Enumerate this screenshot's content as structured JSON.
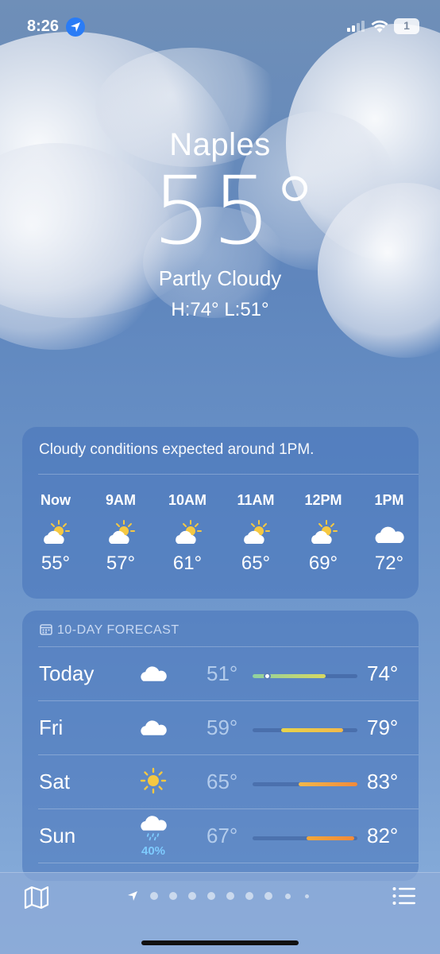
{
  "status_bar": {
    "time": "8:26",
    "battery": "1"
  },
  "location": {
    "city": "Naples",
    "temperature": "55°",
    "condition": "Partly Cloudy",
    "high_low": "H:74°  L:51°"
  },
  "hourly": {
    "summary": "Cloudy conditions expected around 1PM.",
    "hours": [
      {
        "label": "Now",
        "icon": "partly-cloudy-icon",
        "temp": "55°"
      },
      {
        "label": "9AM",
        "icon": "partly-cloudy-icon",
        "temp": "57°"
      },
      {
        "label": "10AM",
        "icon": "partly-cloudy-icon",
        "temp": "61°"
      },
      {
        "label": "11AM",
        "icon": "partly-cloudy-icon",
        "temp": "65°"
      },
      {
        "label": "12PM",
        "icon": "partly-cloudy-icon",
        "temp": "69°"
      },
      {
        "label": "1PM",
        "icon": "cloud-icon",
        "temp": "72°"
      }
    ]
  },
  "daily": {
    "header": "10-DAY FORECAST",
    "days": [
      {
        "name": "Today",
        "icon": "cloud-icon",
        "low": "51°",
        "high": "74°",
        "precip": ""
      },
      {
        "name": "Fri",
        "icon": "cloud-icon",
        "low": "59°",
        "high": "79°",
        "precip": ""
      },
      {
        "name": "Sat",
        "icon": "sun-icon",
        "low": "65°",
        "high": "83°",
        "precip": ""
      },
      {
        "name": "Sun",
        "icon": "rain-cloud-icon",
        "low": "67°",
        "high": "82°",
        "precip": "40%"
      }
    ]
  },
  "colors": {
    "accent_blue": "#2a7cf6",
    "precip_blue": "#7ecbff",
    "bar_green": "#8fd2a0",
    "bar_yellow": "#f2cf4a",
    "bar_orange": "#f29a3a"
  }
}
